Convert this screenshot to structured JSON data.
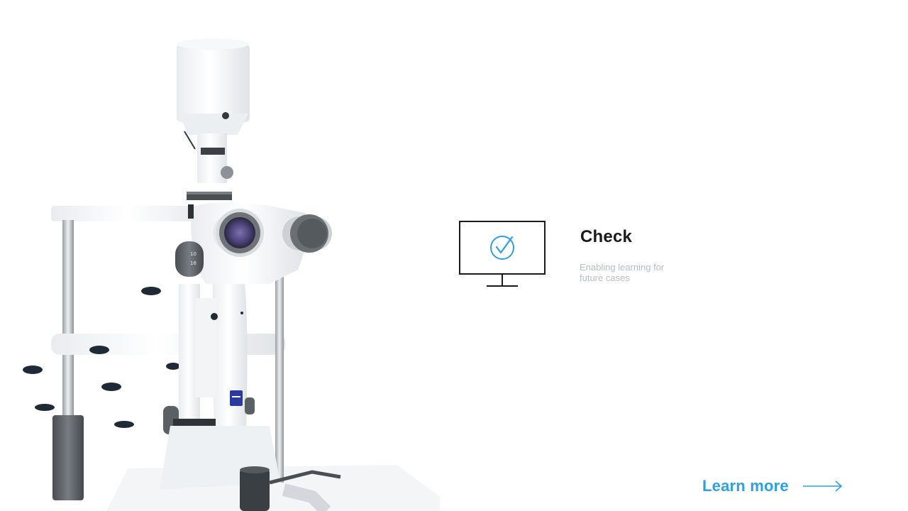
{
  "feature": {
    "title": "Check",
    "description": "Enabling learning for future cases",
    "icon": "monitor-check-icon"
  },
  "cta": {
    "label": "Learn more",
    "icon": "arrow-right-icon"
  },
  "colors": {
    "accent": "#2f9fe0",
    "title": "#1a1a1a",
    "description": "#b9bcc2",
    "background": "#ffffff",
    "instrument_dark": "#55595e",
    "lens_purple": "#5a4f86",
    "badge_blue": "#2b3a9e"
  }
}
